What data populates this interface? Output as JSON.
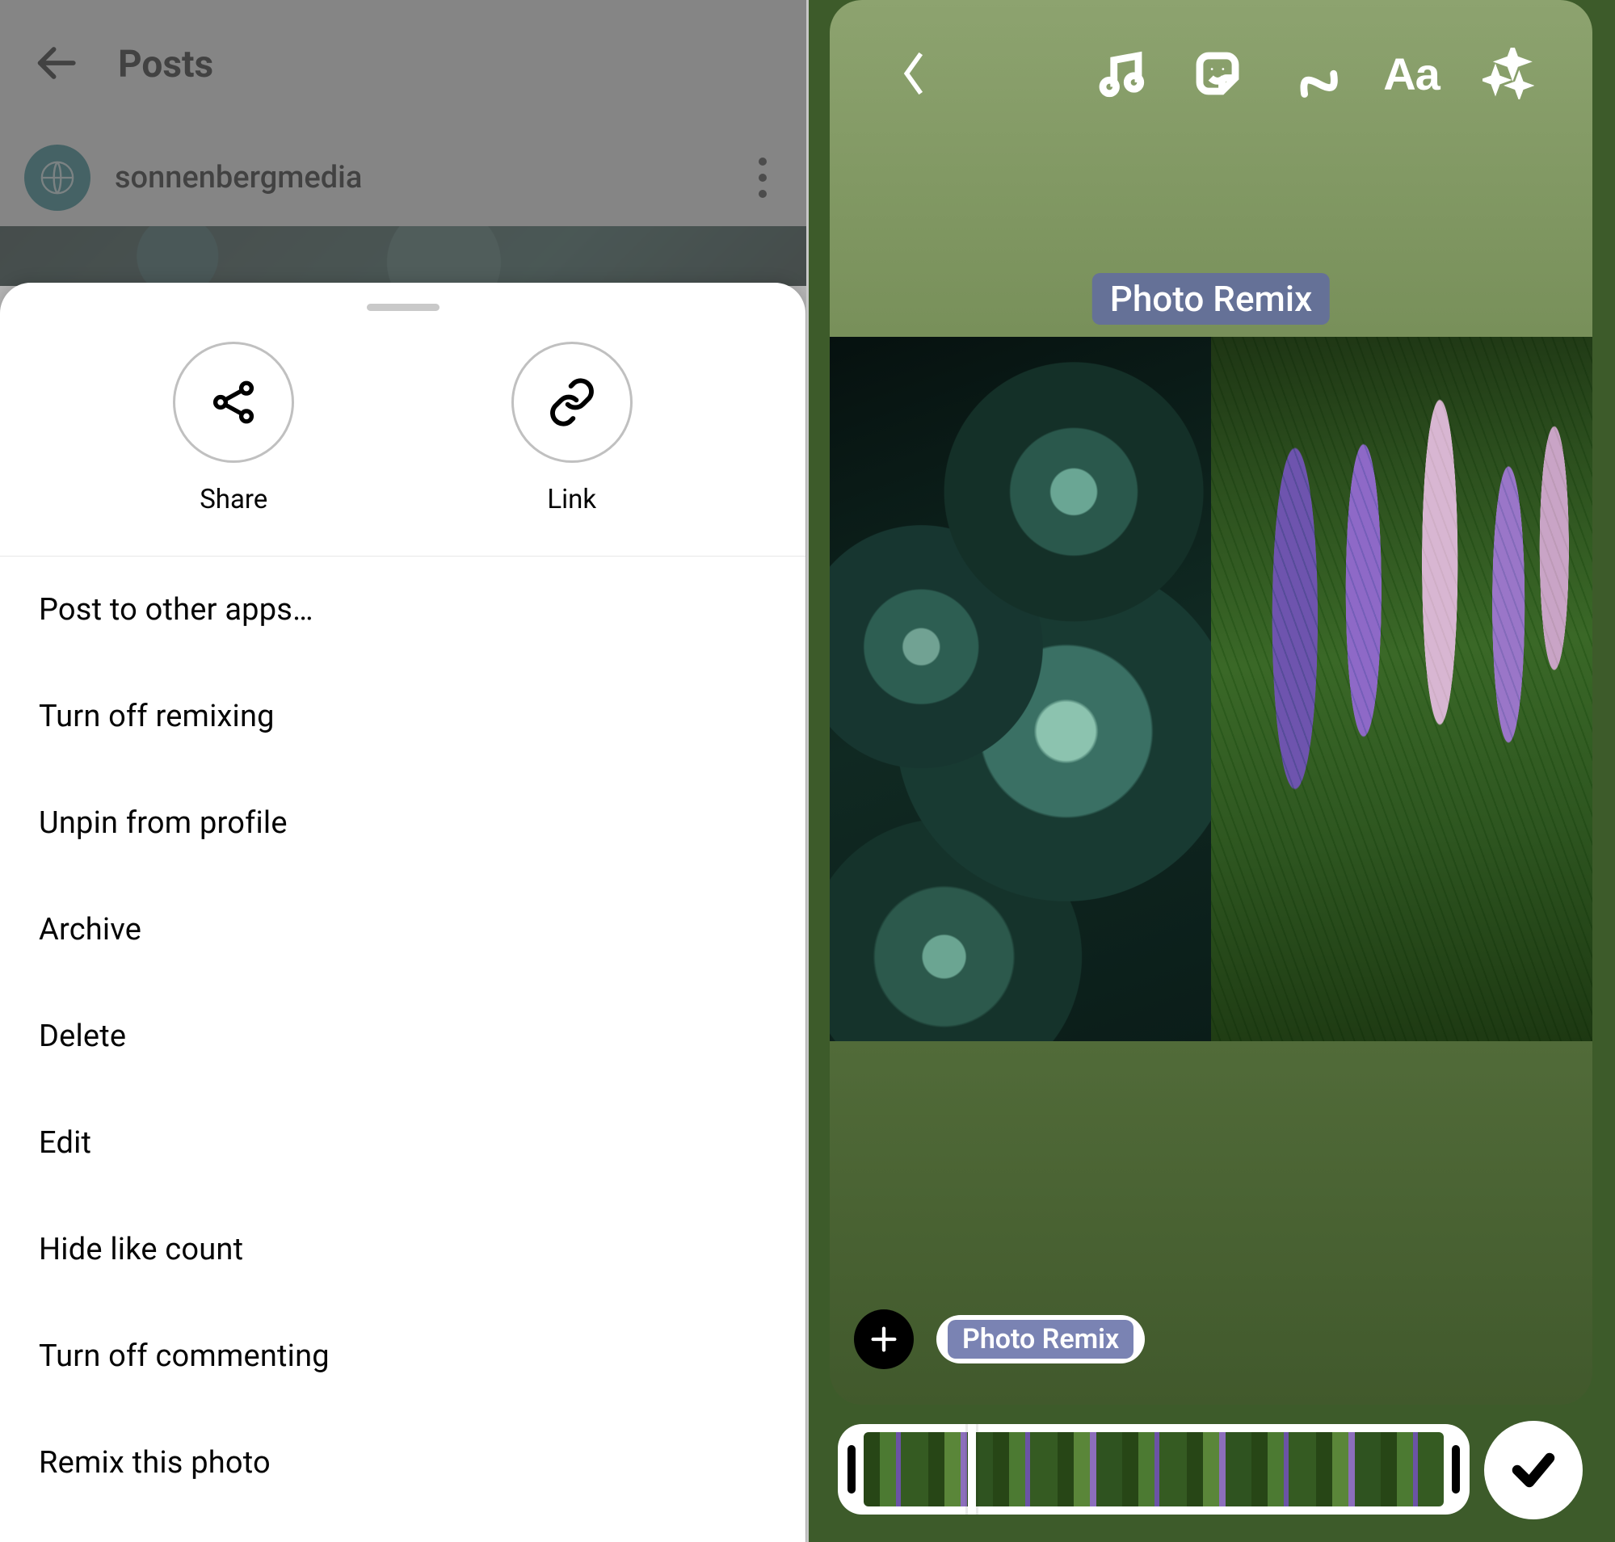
{
  "left": {
    "header_title": "Posts",
    "username": "sonnenbergmedia",
    "actions": {
      "share": "Share",
      "link": "Link"
    },
    "menu": [
      "Post to other apps…",
      "Turn off remixing",
      "Unpin from profile",
      "Archive",
      "Delete",
      "Edit",
      "Hide like count",
      "Turn off commenting",
      "Remix this photo"
    ]
  },
  "right": {
    "badge_label": "Photo Remix",
    "chip_label": "Photo Remix",
    "topbar_text_tool": "Aa"
  }
}
